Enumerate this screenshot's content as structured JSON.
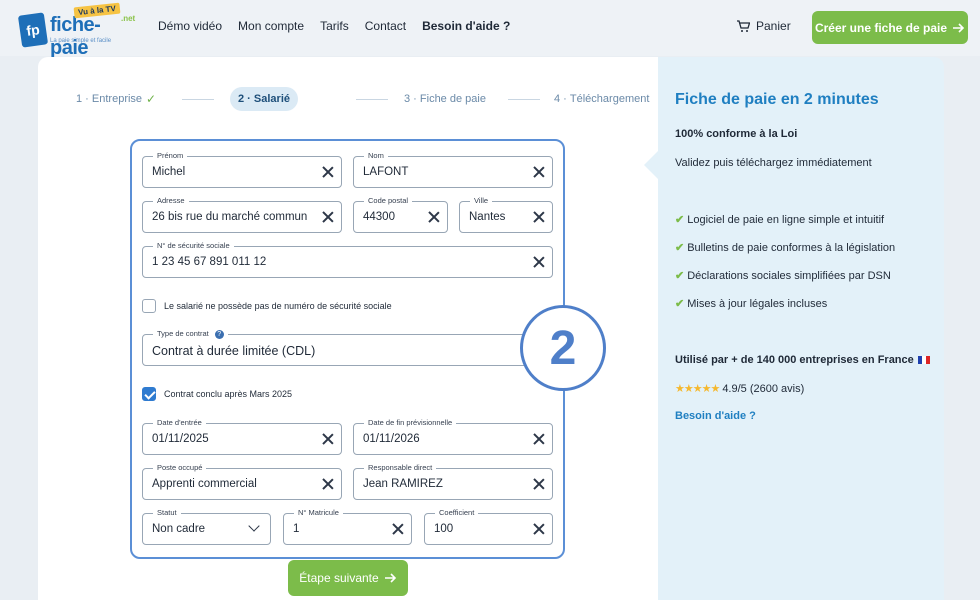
{
  "header": {
    "logo_name": "fiche-paie",
    "logo_tv": "Vu à la TV",
    "logo_net": ".net",
    "logo_tagline": "La paie simple et facile",
    "nav": [
      "Démo vidéo",
      "Mon compte",
      "Tarifs",
      "Contact",
      "Besoin d'aide ?"
    ],
    "cart": "Panier",
    "cta": "Créer une fiche de paie"
  },
  "steps": [
    {
      "num": "1",
      "label": "Entreprise",
      "done": "✓"
    },
    {
      "num": "2",
      "label": "Salarié"
    },
    {
      "num": "3",
      "label": "Fiche de paie"
    },
    {
      "num": "4",
      "label": "Téléchargement"
    }
  ],
  "form": {
    "prenom": {
      "label": "Prénom",
      "value": "Michel"
    },
    "nom": {
      "label": "Nom",
      "value": "LAFONT"
    },
    "adresse": {
      "label": "Adresse",
      "value": "26 bis rue du marché commun"
    },
    "code_postal": {
      "label": "Code postal",
      "value": "44300"
    },
    "ville": {
      "label": "Ville",
      "value": "Nantes"
    },
    "secu": {
      "label": "N° de sécurité sociale",
      "value": "1 23 45 67 891 011 12"
    },
    "no_secu_checkbox": "Le salarié ne possède pas de numéro de sécurité sociale",
    "type_contrat": {
      "label": "Type de contrat",
      "value": "Contrat à durée limitée (CDL)"
    },
    "contrat_checkbox": "Contrat conclu après Mars 2025",
    "date_entree": {
      "label": "Date d'entrée",
      "value": "01/11/2025"
    },
    "date_fin": {
      "label": "Date de fin prévisionnelle",
      "value": "01/11/2026"
    },
    "poste": {
      "label": "Poste occupé",
      "value": "Apprenti commercial"
    },
    "responsable": {
      "label": "Responsable direct",
      "value": "Jean RAMIREZ"
    },
    "statut": {
      "label": "Statut",
      "value": "Non cadre"
    },
    "matricule": {
      "label": "N° Matricule",
      "value": "1"
    },
    "coefficient": {
      "label": "Coefficient",
      "value": "100"
    },
    "step_badge": "2",
    "next_button": "Étape suivante"
  },
  "side": {
    "title": "Fiche de paie en 2 minutes",
    "subtitle": "100% conforme à la Loi",
    "text": "Validez puis téléchargez immédiatement",
    "features": [
      "Logiciel de paie en ligne simple et intuitif",
      "Bulletins de paie conformes à la législation",
      "Déclarations sociales simplifiées par DSN",
      "Mises à jour légales incluses"
    ],
    "used_by": "Utilisé par + de 140 000 entreprises en France",
    "rating": "4.9/5 (2600 avis)",
    "help": "Besoin d'aide ?"
  }
}
